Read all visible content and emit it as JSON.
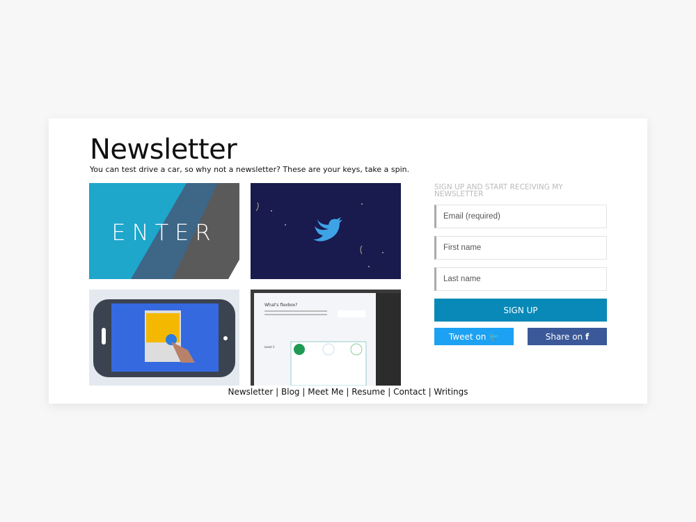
{
  "header": {
    "title": "Newsletter",
    "subtitle": "You can test drive a car, so why not a newsletter? These are your keys, take a spin."
  },
  "tiles": [
    {
      "label": "ENTER"
    },
    {
      "icon": "twitter-bird-icon"
    },
    {
      "icon": "tablet-touch-icon"
    },
    {
      "heading": "What's flexbox?",
      "level": "Level 1"
    }
  ],
  "signup": {
    "heading": "SIGN UP AND START RECEIVING MY NEWSLETTER",
    "email_placeholder": "Email (required)",
    "first_placeholder": "First name",
    "last_placeholder": "Last name",
    "submit": "SIGN UP",
    "tweet": "Tweet on",
    "share": "Share on"
  },
  "footer": {
    "links": [
      "Newsletter",
      "Blog",
      "Meet Me",
      "Resume",
      "Contact",
      "Writings"
    ],
    "separator": " | "
  },
  "colors": {
    "signup": "#0889b7",
    "twitter": "#1da1f2",
    "facebook": "#3b5998"
  }
}
